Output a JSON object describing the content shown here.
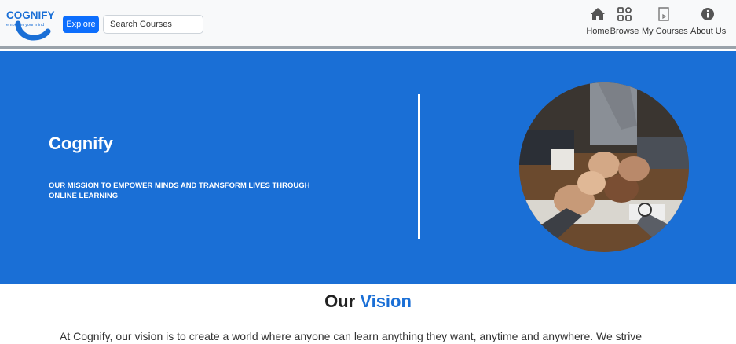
{
  "brand": {
    "name": "COGNIFY",
    "tagline": "empower your mind",
    "color": "#1a6fd6"
  },
  "navbar": {
    "explore_label": "Explore",
    "search_placeholder": "Search Courses",
    "items": [
      {
        "label": "Home",
        "icon": "home-icon"
      },
      {
        "label": "Browse",
        "icon": "browse-grid-icon"
      },
      {
        "label": "My Courses",
        "icon": "book-icon"
      },
      {
        "label": "About Us",
        "icon": "info-icon"
      }
    ]
  },
  "hero": {
    "title": "Cognify",
    "subtitle": "OUR MISSION TO EMPOWER MINDS AND TRANSFORM LIVES THROUGH ONLINE LEARNING",
    "image": "team-fist-bump-photo",
    "background_color": "#1a6fd6"
  },
  "vision": {
    "title_prefix": "Our",
    "title_accent": "Vision",
    "text": "At Cognify, our vision is to create a world where anyone can learn anything they want, anytime and anywhere. We strive"
  }
}
